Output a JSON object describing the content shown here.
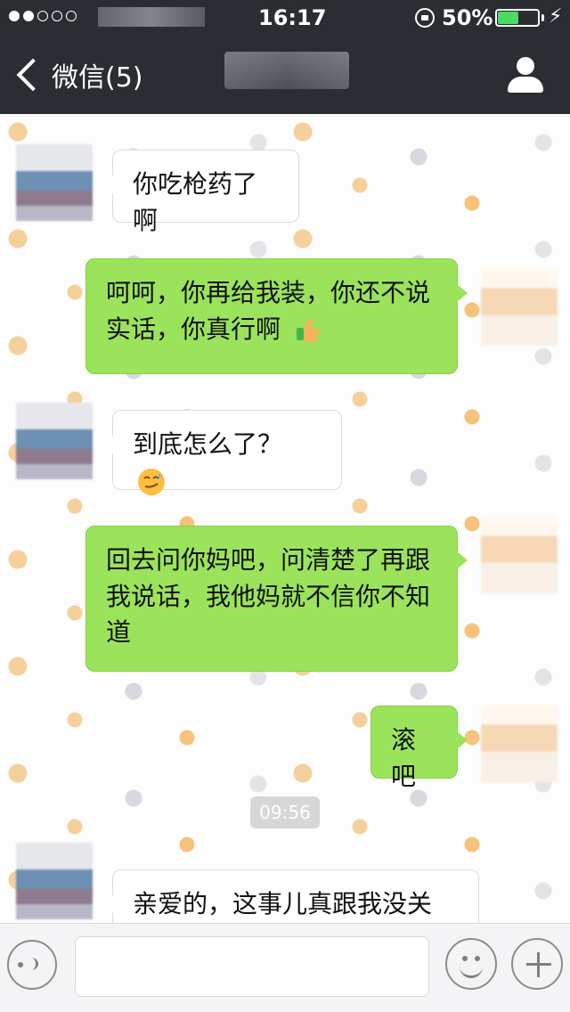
{
  "status_bar": {
    "time": "16:17",
    "battery_percent": "50%",
    "battery_level": 0.5
  },
  "navigation": {
    "back_label": "微信(5)"
  },
  "messages": [
    {
      "side": "left",
      "text": "你吃枪药了啊"
    },
    {
      "side": "right",
      "text": "呵呵，你再给我装，你还不说实话，你真行啊",
      "emoji": "thumbs-up-emoji"
    },
    {
      "side": "left",
      "text": "到底怎么了？",
      "emoji": "smirk-sweat-emoji"
    },
    {
      "side": "right",
      "text": "回去问你妈吧，问清楚了再跟我说话，我他妈就不信你不知道"
    },
    {
      "side": "right",
      "text": "滚吧"
    },
    {
      "side": "left",
      "text": "亲爱的，这事儿真跟我没关"
    }
  ],
  "timestamp": "09:56",
  "input": {
    "value": ""
  },
  "icons": {
    "voice": "voice-icon",
    "emoji": "emoji-icon",
    "plus": "plus-icon",
    "back": "chevron-left-icon",
    "profile": "person-icon"
  },
  "colors": {
    "topbar": "#2a2d31",
    "sent_bubble": "#9be35b",
    "received_bubble": "#ffffff"
  }
}
